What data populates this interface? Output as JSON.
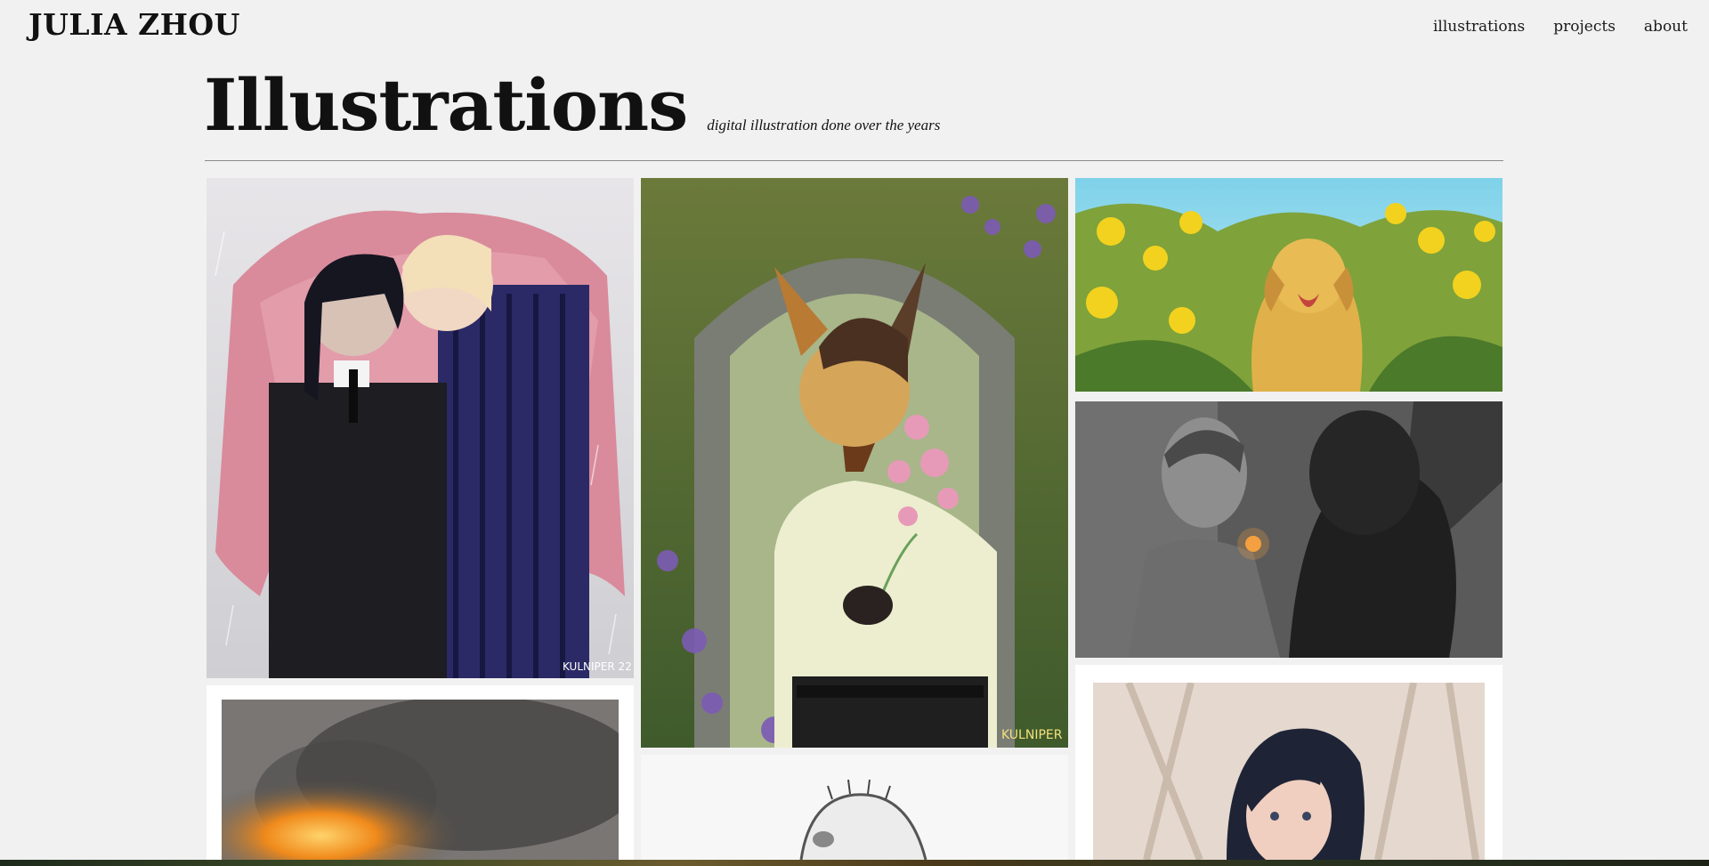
{
  "header": {
    "site_title": "JULIA ZHOU",
    "nav": [
      "illustrations",
      "projects",
      "about"
    ]
  },
  "page": {
    "title": "Illustrations",
    "subtitle": "digital illustration done over the years"
  },
  "gallery": {
    "items": [
      {
        "name": "illustration-rain-umbrella-duo",
        "signature": "KULNIPER 22"
      },
      {
        "name": "illustration-wolf-with-flowers",
        "signature": "KULNIPER"
      },
      {
        "name": "illustration-golden-dog-in-flowers"
      },
      {
        "name": "illustration-grayscale-lighting-cigarette"
      },
      {
        "name": "illustration-grayscale-fire"
      },
      {
        "name": "illustration-sketch-animal"
      },
      {
        "name": "illustration-dark-haired-portrait"
      }
    ]
  },
  "colors": {
    "background": "#f1f1f1",
    "text": "#111111",
    "rule": "#8a8a8a"
  }
}
